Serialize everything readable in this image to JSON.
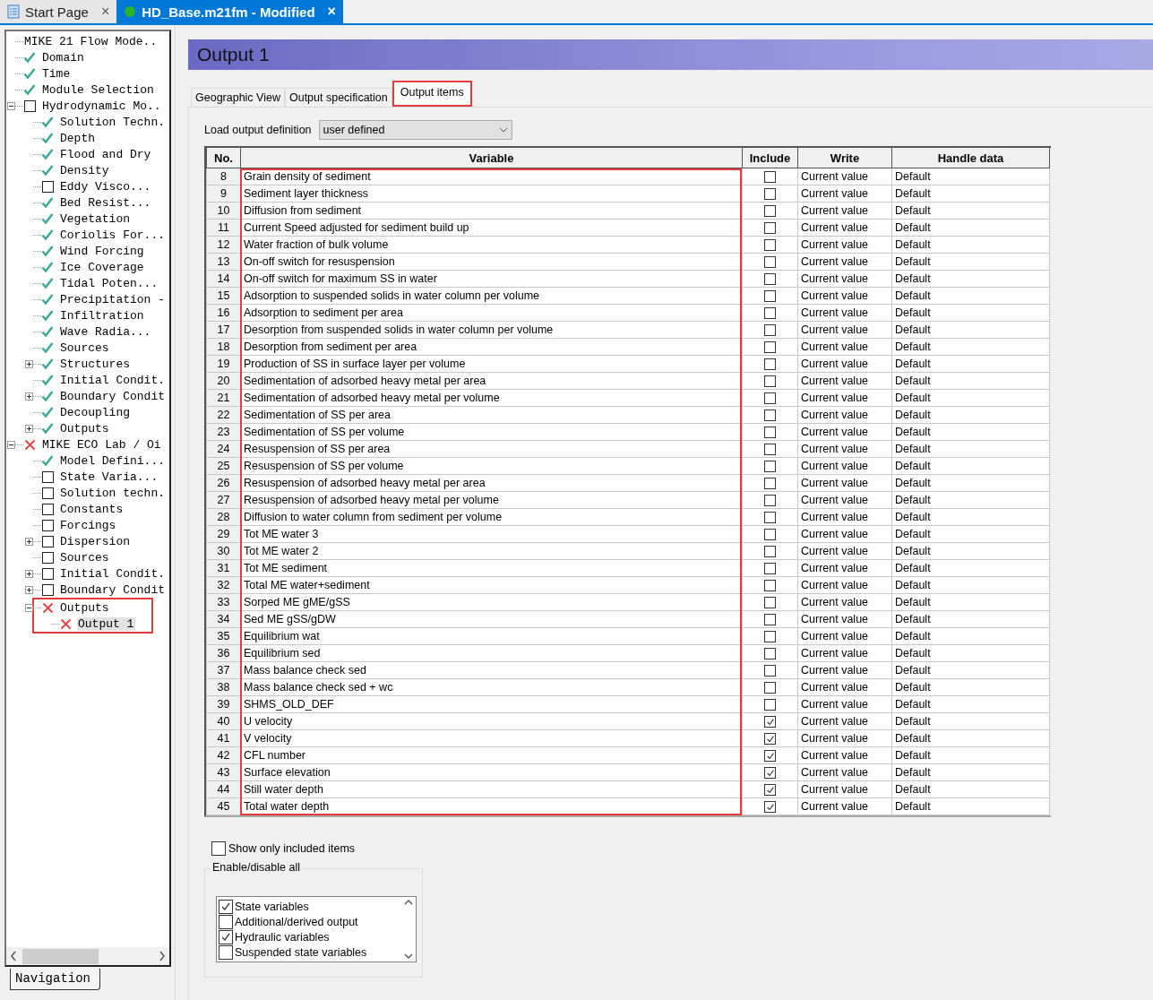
{
  "doc_tabs": [
    {
      "label": "Start Page",
      "kind": "page",
      "selected": false,
      "close": "×"
    },
    {
      "label": "HD_Base.m21fm - Modified",
      "kind": "model",
      "selected": true,
      "close": "×"
    }
  ],
  "tree": [
    {
      "label": "MIKE 21 Flow Mode..",
      "kind": "none"
    },
    {
      "label": "Domain",
      "kind": "check"
    },
    {
      "label": "Time",
      "kind": "check"
    },
    {
      "label": "Module Selection",
      "kind": "check"
    },
    {
      "label": "Hydrodynamic Mo..",
      "kind": "box",
      "expanded": true,
      "children": [
        {
          "label": "Solution Techn.",
          "kind": "check"
        },
        {
          "label": "Depth",
          "kind": "check"
        },
        {
          "label": "Flood and Dry",
          "kind": "check"
        },
        {
          "label": "Density",
          "kind": "check"
        },
        {
          "label": "Eddy Visco...",
          "kind": "box"
        },
        {
          "label": "Bed Resist...",
          "kind": "check"
        },
        {
          "label": "Vegetation",
          "kind": "check"
        },
        {
          "label": "Coriolis For...",
          "kind": "check"
        },
        {
          "label": "Wind Forcing",
          "kind": "check"
        },
        {
          "label": "Ice Coverage",
          "kind": "check"
        },
        {
          "label": "Tidal Poten...",
          "kind": "check"
        },
        {
          "label": "Precipitation -",
          "kind": "check"
        },
        {
          "label": "Infiltration",
          "kind": "check"
        },
        {
          "label": "Wave Radia...",
          "kind": "check"
        },
        {
          "label": "Sources",
          "kind": "check"
        },
        {
          "label": "Structures",
          "kind": "check",
          "expanded": false
        },
        {
          "label": "Initial Condit.",
          "kind": "check"
        },
        {
          "label": "Boundary Condit",
          "kind": "check",
          "expanded": false
        },
        {
          "label": "Decoupling",
          "kind": "check"
        },
        {
          "label": "Outputs",
          "kind": "check",
          "expanded": false
        }
      ]
    },
    {
      "label": "MIKE ECO Lab / Oi",
      "kind": "cross",
      "expanded": true,
      "children": [
        {
          "label": "Model Defini...",
          "kind": "check"
        },
        {
          "label": "State Varia...",
          "kind": "box"
        },
        {
          "label": "Solution techn.",
          "kind": "box"
        },
        {
          "label": "Constants",
          "kind": "box"
        },
        {
          "label": "Forcings",
          "kind": "box"
        },
        {
          "label": "Dispersion",
          "kind": "box",
          "expanded": false
        },
        {
          "label": "Sources",
          "kind": "box"
        },
        {
          "label": "Initial Condit.",
          "kind": "box",
          "expanded": false
        },
        {
          "label": "Boundary Condit",
          "kind": "box",
          "expanded": false
        },
        {
          "label": "Outputs",
          "kind": "cross",
          "expanded": true,
          "highlighted": true,
          "children": [
            {
              "label": "Output 1",
              "kind": "cross",
              "selected": true
            }
          ]
        }
      ]
    }
  ],
  "nav_tab": "Navigation",
  "title": "Output 1",
  "tabs": [
    {
      "label": "Geographic View",
      "selected": false,
      "highlighted": false
    },
    {
      "label": "Output specification",
      "selected": false,
      "highlighted": false
    },
    {
      "label": "Output items",
      "selected": true,
      "highlighted": true
    }
  ],
  "load_definition": {
    "label": "Load output definition",
    "value": "user defined"
  },
  "table": {
    "columns": [
      "No.",
      "Variable",
      "Include",
      "Write",
      "Handle data"
    ],
    "variable_highlighted": true,
    "rows": [
      {
        "no": "8",
        "variable": "Grain density of sediment",
        "include": false,
        "write": "Current value",
        "handle": "Default"
      },
      {
        "no": "9",
        "variable": "Sediment layer thickness",
        "include": false,
        "write": "Current value",
        "handle": "Default"
      },
      {
        "no": "10",
        "variable": "Diffusion from sediment",
        "include": false,
        "write": "Current value",
        "handle": "Default"
      },
      {
        "no": "11",
        "variable": "Current Speed adjusted for sediment build up",
        "include": false,
        "write": "Current value",
        "handle": "Default"
      },
      {
        "no": "12",
        "variable": "Water fraction of bulk volume",
        "include": false,
        "write": "Current value",
        "handle": "Default"
      },
      {
        "no": "13",
        "variable": "On-off switch for resuspension",
        "include": false,
        "write": "Current value",
        "handle": "Default"
      },
      {
        "no": "14",
        "variable": "On-off switch for maximum SS in water",
        "include": false,
        "write": "Current value",
        "handle": "Default"
      },
      {
        "no": "15",
        "variable": "Adsorption to suspended solids in water column per volume",
        "include": false,
        "write": "Current value",
        "handle": "Default"
      },
      {
        "no": "16",
        "variable": "Adsorption to sediment per area",
        "include": false,
        "write": "Current value",
        "handle": "Default"
      },
      {
        "no": "17",
        "variable": "Desorption from suspended solids in water column per volume",
        "include": false,
        "write": "Current value",
        "handle": "Default"
      },
      {
        "no": "18",
        "variable": "Desorption from sediment per area",
        "include": false,
        "write": "Current value",
        "handle": "Default"
      },
      {
        "no": "19",
        "variable": "Production of SS in surface layer per volume",
        "include": false,
        "write": "Current value",
        "handle": "Default"
      },
      {
        "no": "20",
        "variable": "Sedimentation of adsorbed heavy metal per area",
        "include": false,
        "write": "Current value",
        "handle": "Default"
      },
      {
        "no": "21",
        "variable": "Sedimentation of adsorbed heavy metal per volume",
        "include": false,
        "write": "Current value",
        "handle": "Default"
      },
      {
        "no": "22",
        "variable": "Sedimentation of SS per area",
        "include": false,
        "write": "Current value",
        "handle": "Default"
      },
      {
        "no": "23",
        "variable": "Sedimentation of SS per volume",
        "include": false,
        "write": "Current value",
        "handle": "Default"
      },
      {
        "no": "24",
        "variable": "Resuspension of SS per area",
        "include": false,
        "write": "Current value",
        "handle": "Default"
      },
      {
        "no": "25",
        "variable": "Resuspension of SS per volume",
        "include": false,
        "write": "Current value",
        "handle": "Default"
      },
      {
        "no": "26",
        "variable": "Resuspension of adsorbed heavy metal per area",
        "include": false,
        "write": "Current value",
        "handle": "Default"
      },
      {
        "no": "27",
        "variable": "Resuspension of adsorbed heavy metal per volume",
        "include": false,
        "write": "Current value",
        "handle": "Default"
      },
      {
        "no": "28",
        "variable": "Diffusion to water column from sediment per volume",
        "include": false,
        "write": "Current value",
        "handle": "Default"
      },
      {
        "no": "29",
        "variable": "Tot ME water 3",
        "include": false,
        "write": "Current value",
        "handle": "Default"
      },
      {
        "no": "30",
        "variable": "Tot ME water 2",
        "include": false,
        "write": "Current value",
        "handle": "Default"
      },
      {
        "no": "31",
        "variable": "Tot ME sediment",
        "include": false,
        "write": "Current value",
        "handle": "Default"
      },
      {
        "no": "32",
        "variable": "Total ME water+sediment",
        "include": false,
        "write": "Current value",
        "handle": "Default"
      },
      {
        "no": "33",
        "variable": "Sorped ME gME/gSS",
        "include": false,
        "write": "Current value",
        "handle": "Default"
      },
      {
        "no": "34",
        "variable": "Sed ME gSS/gDW",
        "include": false,
        "write": "Current value",
        "handle": "Default"
      },
      {
        "no": "35",
        "variable": "Equilibrium wat",
        "include": false,
        "write": "Current value",
        "handle": "Default"
      },
      {
        "no": "36",
        "variable": "Equilibrium sed",
        "include": false,
        "write": "Current value",
        "handle": "Default"
      },
      {
        "no": "37",
        "variable": "Mass balance check sed",
        "include": false,
        "write": "Current value",
        "handle": "Default"
      },
      {
        "no": "38",
        "variable": "Mass balance check sed + wc",
        "include": false,
        "write": "Current value",
        "handle": "Default"
      },
      {
        "no": "39",
        "variable": "SHMS_OLD_DEF",
        "include": false,
        "write": "Current value",
        "handle": "Default"
      },
      {
        "no": "40",
        "variable": "U velocity",
        "include": true,
        "write": "Current value",
        "handle": "Default"
      },
      {
        "no": "41",
        "variable": "V velocity",
        "include": true,
        "write": "Current value",
        "handle": "Default"
      },
      {
        "no": "42",
        "variable": "CFL number",
        "include": true,
        "write": "Current value",
        "handle": "Default"
      },
      {
        "no": "43",
        "variable": "Surface elevation",
        "include": true,
        "write": "Current value",
        "handle": "Default"
      },
      {
        "no": "44",
        "variable": "Still water depth",
        "include": true,
        "write": "Current value",
        "handle": "Default"
      },
      {
        "no": "45",
        "variable": "Total water depth",
        "include": true,
        "write": "Current value",
        "handle": "Default"
      }
    ]
  },
  "show_only_included": {
    "label": "Show only included items",
    "checked": false
  },
  "enable_group": {
    "title": "Enable/disable all",
    "items": [
      {
        "label": "State variables",
        "checked": true
      },
      {
        "label": "Additional/derived output",
        "checked": false
      },
      {
        "label": "Hydraulic variables",
        "checked": true
      },
      {
        "label": "Suspended state variables",
        "checked": false
      }
    ]
  }
}
